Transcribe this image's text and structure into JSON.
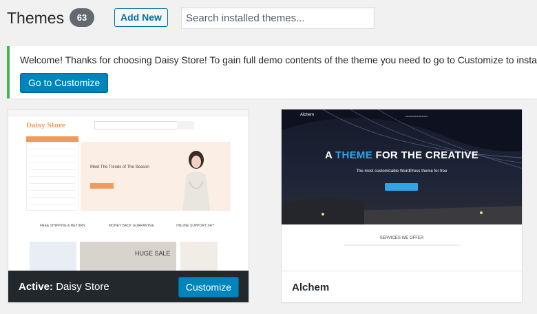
{
  "header": {
    "title": "Themes",
    "count": "63",
    "add_new_label": "Add New",
    "search_placeholder": "Search installed themes..."
  },
  "notice": {
    "text": "Welcome! Thanks for choosing Daisy Store! To gain full demo contents of the theme you need to go to Customize to install & ac",
    "button_label": "Go to Customize"
  },
  "themes": [
    {
      "active_label": "Active:",
      "name": "Daisy Store",
      "button_label": "Customize",
      "preview": {
        "logo": "Daisy Store",
        "hero_text": "Meet The Trends of The Season",
        "sale_text": "HUGE SALE",
        "features": [
          "FREE SHIPPING & RETURN",
          "MONEY BACK GUARANTEE",
          "ONLINE SUPPORT 24/7"
        ]
      }
    },
    {
      "name": "Alchem",
      "preview": {
        "logo": "Alchem",
        "headline_pre": "A ",
        "headline_accent": "THEME",
        "headline_post": " FOR THE CREATIVE",
        "subtitle": "The most customizable WordPress theme for free",
        "section": "SERVICES WE OFFER"
      }
    }
  ],
  "colors": {
    "accent": "#0085ba",
    "notice_border": "#46b450",
    "daisy_orange": "#f19b5b",
    "alchem_blue": "#2fa4e7"
  }
}
